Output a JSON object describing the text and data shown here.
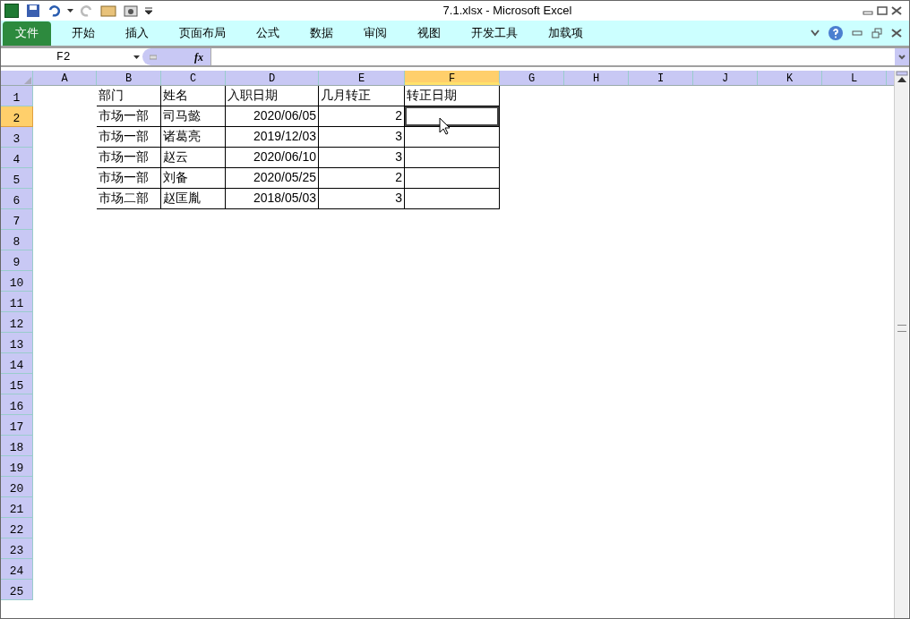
{
  "window": {
    "title": "7.1.xlsx  -  Microsoft Excel"
  },
  "ribbon_tabs": [
    {
      "label": "文件",
      "kind": "file",
      "selected": false
    },
    {
      "label": "开始",
      "kind": "tab",
      "selected": false
    },
    {
      "label": "插入",
      "kind": "tab",
      "selected": false
    },
    {
      "label": "页面布局",
      "kind": "tab",
      "selected": false
    },
    {
      "label": "公式",
      "kind": "tab",
      "selected": false
    },
    {
      "label": "数据",
      "kind": "tab",
      "selected": false
    },
    {
      "label": "审阅",
      "kind": "tab",
      "selected": false
    },
    {
      "label": "视图",
      "kind": "tab",
      "selected": false
    },
    {
      "label": "开发工具",
      "kind": "tab",
      "selected": false
    },
    {
      "label": "加载项",
      "kind": "tab",
      "selected": false
    }
  ],
  "formula_bar": {
    "name_box": "F2",
    "function_label": "fx"
  },
  "column_headers": [
    {
      "label": "A",
      "selected": false
    },
    {
      "label": "B",
      "selected": false
    },
    {
      "label": "C",
      "selected": false
    },
    {
      "label": "D",
      "selected": false
    },
    {
      "label": "E",
      "selected": false
    },
    {
      "label": "F",
      "selected": true
    },
    {
      "label": "G",
      "selected": false
    },
    {
      "label": "H",
      "selected": false
    },
    {
      "label": "I",
      "selected": false
    },
    {
      "label": "J",
      "selected": false
    },
    {
      "label": "K",
      "selected": false
    },
    {
      "label": "L",
      "selected": false
    }
  ],
  "row_headers": [
    {
      "label": "1",
      "selected": false
    },
    {
      "label": "2",
      "selected": true
    },
    {
      "label": "3",
      "selected": false
    },
    {
      "label": "4",
      "selected": false
    },
    {
      "label": "5",
      "selected": false
    },
    {
      "label": "6",
      "selected": false
    },
    {
      "label": "7",
      "selected": false
    },
    {
      "label": "8",
      "selected": false
    },
    {
      "label": "9",
      "selected": false
    },
    {
      "label": "10",
      "selected": false
    },
    {
      "label": "11",
      "selected": false
    },
    {
      "label": "12",
      "selected": false
    },
    {
      "label": "13",
      "selected": false
    },
    {
      "label": "14",
      "selected": false
    },
    {
      "label": "15",
      "selected": false
    },
    {
      "label": "16",
      "selected": false
    },
    {
      "label": "17",
      "selected": false
    },
    {
      "label": "18",
      "selected": false
    },
    {
      "label": "19",
      "selected": false
    },
    {
      "label": "20",
      "selected": false
    },
    {
      "label": "21",
      "selected": false
    },
    {
      "label": "22",
      "selected": false
    },
    {
      "label": "23",
      "selected": false
    },
    {
      "label": "24",
      "selected": false
    },
    {
      "label": "25",
      "selected": false
    }
  ],
  "table_rows": [
    {
      "cells": [
        {
          "text": "部门",
          "kind": "text"
        },
        {
          "text": "姓名",
          "kind": "text"
        },
        {
          "text": "入职日期",
          "kind": "text"
        },
        {
          "text": "几月转正",
          "kind": "text"
        },
        {
          "text": "转正日期",
          "kind": "text"
        }
      ]
    },
    {
      "cells": [
        {
          "text": "市场一部",
          "kind": "text"
        },
        {
          "text": "司马懿",
          "kind": "text"
        },
        {
          "text": "2020/06/05",
          "kind": "number"
        },
        {
          "text": "2",
          "kind": "number"
        }
      ]
    },
    {
      "cells": [
        {
          "text": "市场一部",
          "kind": "text"
        },
        {
          "text": "诸葛亮",
          "kind": "text"
        },
        {
          "text": "2019/12/03",
          "kind": "number"
        },
        {
          "text": "3",
          "kind": "number"
        }
      ]
    },
    {
      "cells": [
        {
          "text": "市场一部",
          "kind": "text"
        },
        {
          "text": "赵云",
          "kind": "text"
        },
        {
          "text": "2020/06/10",
          "kind": "number"
        },
        {
          "text": "3",
          "kind": "number"
        }
      ]
    },
    {
      "cells": [
        {
          "text": "市场一部",
          "kind": "text"
        },
        {
          "text": "刘备",
          "kind": "text"
        },
        {
          "text": "2020/05/25",
          "kind": "number"
        },
        {
          "text": "2",
          "kind": "number"
        }
      ]
    },
    {
      "cells": [
        {
          "text": "市场二部",
          "kind": "text"
        },
        {
          "text": "赵匡胤",
          "kind": "text"
        },
        {
          "text": "2018/05/03",
          "kind": "number"
        },
        {
          "text": "3",
          "kind": "number"
        }
      ]
    }
  ]
}
